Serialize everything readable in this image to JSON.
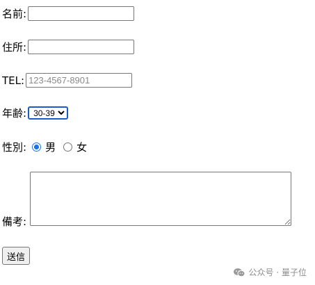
{
  "form": {
    "name": {
      "label": "名前:",
      "value": ""
    },
    "address": {
      "label": "住所:",
      "value": ""
    },
    "tel": {
      "label": "TEL:",
      "value": "",
      "placeholder": "123-4567-8901"
    },
    "age": {
      "label": "年齢:",
      "selected": "30-39"
    },
    "gender": {
      "label": "性別:",
      "options": [
        {
          "label": "男",
          "checked": true
        },
        {
          "label": "女",
          "checked": false
        }
      ]
    },
    "remarks": {
      "label": "備考:",
      "value": ""
    },
    "submit_label": "送信"
  },
  "watermark": {
    "text": "公众号 · 量子位",
    "icon": "wechat-icon"
  },
  "colors": {
    "focus_accent": "#1a5cc7",
    "radio_accent": "#1a73e8",
    "watermark": "#8c8c8c"
  }
}
